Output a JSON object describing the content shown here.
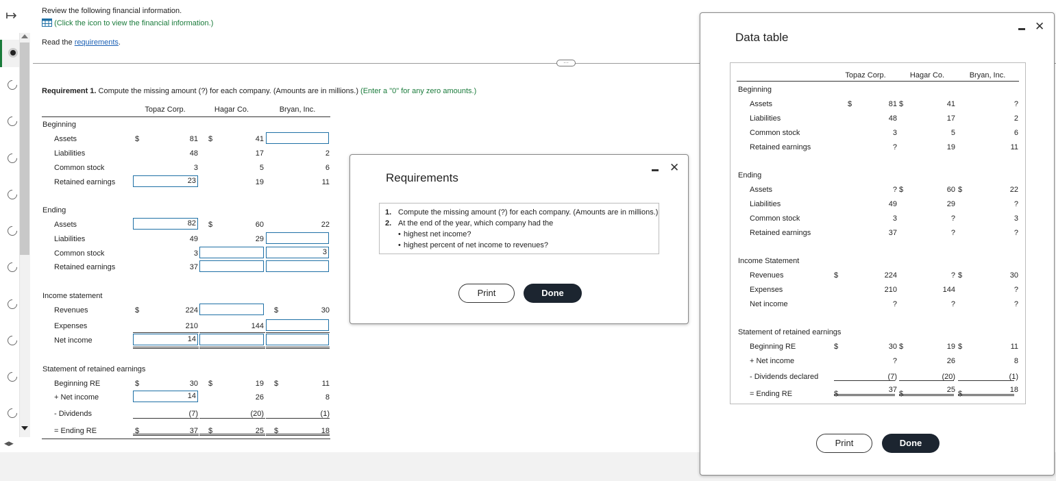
{
  "intro": {
    "line1": "Review the following financial information.",
    "line2": "(Click the icon to view the financial information.)",
    "read_prefix": "Read the ",
    "read_link": "requirements",
    "read_suffix": "."
  },
  "req1": {
    "bold": "Requirement 1.",
    "text": " Compute the missing amount (?) for each company. (Amounts are in millions.) ",
    "green": "(Enter a \"0\" for any zero amounts.)"
  },
  "cols": [
    "Topaz Corp.",
    "Hagar Co.",
    "Bryan, Inc."
  ],
  "sections": {
    "beginning": "Beginning",
    "ending": "Ending",
    "income": "Income statement",
    "re": "Statement of retained earnings"
  },
  "labels": {
    "assets": "Assets",
    "liabilities": "Liabilities",
    "common": "Common stock",
    "retained": "Retained earnings",
    "revenues": "Revenues",
    "expenses": "Expenses",
    "net_income": "Net income",
    "beg_re": "Beginning RE",
    "plus_ni": "+ Net income",
    "minus_div": "- Dividends",
    "end_re": "= Ending RE"
  },
  "dollar": "$",
  "main_values": {
    "b_assets": [
      "81",
      "41",
      ""
    ],
    "b_liab": [
      "48",
      "17",
      "2"
    ],
    "b_common": [
      "3",
      "5",
      "6"
    ],
    "b_re": [
      "23",
      "19",
      "11"
    ],
    "e_assets": [
      "82",
      "60",
      "22"
    ],
    "e_liab": [
      "49",
      "29",
      ""
    ],
    "e_common": [
      "3",
      "",
      "3"
    ],
    "e_re": [
      "37",
      "",
      ""
    ],
    "rev": [
      "224",
      "",
      "30"
    ],
    "exp": [
      "210",
      "144",
      ""
    ],
    "ni": [
      "14",
      "",
      ""
    ],
    "bre": [
      "30",
      "19",
      "11"
    ],
    "pni": [
      "14",
      "26",
      "8"
    ],
    "div": [
      "(7)",
      "(20)",
      "(1)"
    ],
    "ere": [
      "37",
      "25",
      "18"
    ]
  },
  "requirements_modal": {
    "title": "Requirements",
    "items": [
      "Compute the missing amount (?) for each company. (Amounts are in millions.)",
      "At the end of the year, which company had the"
    ],
    "bullets": [
      "highest net income?",
      "highest percent of net income to revenues?"
    ],
    "nums": [
      "1.",
      "2."
    ],
    "print": "Print",
    "done": "Done"
  },
  "data_table": {
    "title": "Data table",
    "cols": [
      "Topaz Corp.",
      "Hagar Co.",
      "Bryan, Inc."
    ],
    "sections": {
      "beginning": "Beginning",
      "ending": "Ending",
      "income": "Income Statement",
      "re": "Statement of retained earnings"
    },
    "labels": {
      "assets": "Assets",
      "liabilities": "Liabilities",
      "common": "Common stock",
      "retained": "Retained earnings",
      "revenues": "Revenues",
      "expenses": "Expenses",
      "net_income": "Net income",
      "beg_re": "Beginning RE",
      "plus_ni": "+ Net income",
      "div": "- Dividends declared",
      "end_re": "= Ending RE"
    },
    "values": {
      "b_assets": [
        "81",
        "41",
        "?"
      ],
      "b_liab": [
        "48",
        "17",
        "2"
      ],
      "b_common": [
        "3",
        "5",
        "6"
      ],
      "b_re": [
        "?",
        "19",
        "11"
      ],
      "e_assets": [
        "?",
        "60",
        "22"
      ],
      "e_liab": [
        "49",
        "29",
        "?"
      ],
      "e_common": [
        "3",
        "?",
        "3"
      ],
      "e_re": [
        "37",
        "?",
        "?"
      ],
      "rev": [
        "224",
        "?",
        "30"
      ],
      "exp": [
        "210",
        "144",
        "?"
      ],
      "ni": [
        "?",
        "?",
        "?"
      ],
      "bre": [
        "30",
        "19",
        "11"
      ],
      "pni": [
        "?",
        "26",
        "8"
      ],
      "div": [
        "(7)",
        "(20)",
        "(1)"
      ],
      "ere": [
        "37",
        "25",
        "18"
      ]
    },
    "print": "Print",
    "done": "Done"
  },
  "icons": [
    "expand-arrow-icon",
    "table-grid-icon",
    "minimize-icon",
    "close-icon",
    "scroll-up-icon",
    "scroll-down-icon"
  ]
}
